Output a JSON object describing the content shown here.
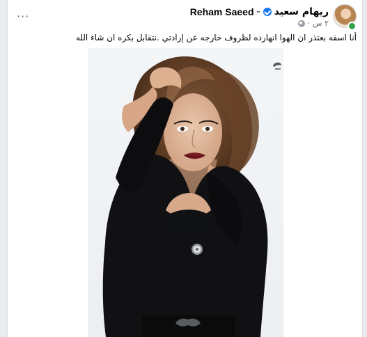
{
  "post": {
    "author_ar": "ريهام سعيد",
    "separator": "-",
    "author_en": "Reham Saeed",
    "timestamp": "٢ س",
    "text": "أنا اسفه بعتذر ان الهوا انهارده لظروف خارجه عن إرادتي .نتقابل بكره ان شاء الله",
    "menu": "···"
  },
  "icons": {
    "verified": "verified-badge-icon",
    "globe": "public-globe-icon",
    "menu": "more-options-icon"
  },
  "colors": {
    "page_bg": "#e9ebee",
    "card_bg": "#ffffff",
    "verified_blue": "#1877f2",
    "meta_gray": "#65676b"
  }
}
